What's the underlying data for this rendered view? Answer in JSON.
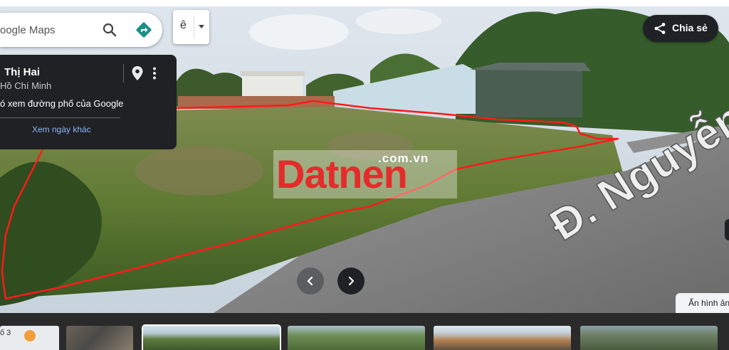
{
  "search": {
    "placeholder": "oogle Maps"
  },
  "layers": {
    "label": "ê"
  },
  "share": {
    "label": "Chia sẻ"
  },
  "info_card": {
    "title": "Thị Hai",
    "subtitle": "Hồ Chí Minh",
    "street_view_note": "ó xem đường phố của Google",
    "other_dates": "Xem ngày khác"
  },
  "watermark": {
    "logo": "Datnen",
    "domain": ".com.vn"
  },
  "road_text": "Đ. Nguyễn Th",
  "hide_images": {
    "label": "Ẩn hình ảnh"
  },
  "thumbnails": [
    {
      "label": "ố 3"
    },
    {},
    {},
    {},
    {},
    {}
  ],
  "colors": {
    "panel_dark": "#202124",
    "link_blue": "#8ab4f8",
    "directions_teal": "#1a8f85",
    "annotation_red": "#ff1a1a",
    "watermark_red": "#e52b2b"
  },
  "icons": [
    "search-icon",
    "directions-icon",
    "share-icon",
    "pin-icon",
    "more-vert-icon",
    "chevron-left-icon",
    "chevron-right-icon"
  ]
}
